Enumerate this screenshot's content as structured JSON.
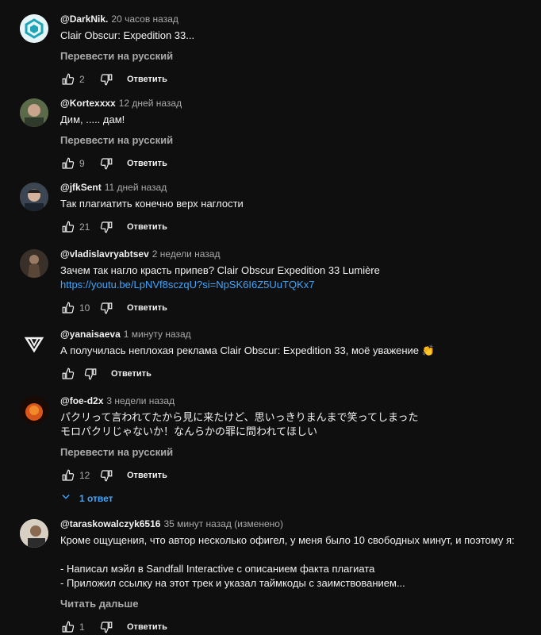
{
  "comments": [
    {
      "author": "@DarkNik.",
      "time": "20 часов назад",
      "text": "Clair Obscur: Expedition 33...",
      "translate": "Перевести на русский",
      "likes": "2",
      "reply": "Ответить"
    },
    {
      "author": "@Kortexxxx",
      "time": "12 дней назад",
      "text": "Дим, ..... дам!",
      "translate": "Перевести на русский",
      "likes": "9",
      "reply": "Ответить"
    },
    {
      "author": "@jfkSent",
      "time": "11 дней назад",
      "text": "Так плагиатить конечно верх наглости",
      "likes": "21",
      "reply": "Ответить"
    },
    {
      "author": "@vladislavryabtsev",
      "time": "2 недели назад",
      "text": "Зачем так нагло красть припев? Clair Obscur Expedition 33 Lumière",
      "link": "https://youtu.be/LpNVf8sczqU?si=NpSK6I6Z5UuTQKx7",
      "likes": "10",
      "reply": "Ответить"
    },
    {
      "author": "@yanaisaeva",
      "time": "1 минуту назад",
      "text": "А получилась неплохая реклама Clair Obscur: Expedition 33, моё уважение 👏",
      "likes": "",
      "reply": "Ответить"
    },
    {
      "author": "@foe-d2x",
      "time": "3 недели назад",
      "text": "パクリって言われてたから見に来たけど、思いっきりまんまで笑ってしまった\nモロパクリじゃないか！なんらかの罪に問われてほしい",
      "translate": "Перевести на русский",
      "likes": "12",
      "reply": "Ответить",
      "replies": "1 ответ"
    },
    {
      "author": "@taraskowalczyk6516",
      "time": "35 минут назад (изменено)",
      "text": "Кроме ощущения, что автор несколько офигел, у меня было 10 свободных минут, и поэтому я:\n\n- Написал мэйл в Sandfall Interactive с описанием факта плагиата\n- Приложил ссылку на этот трек и указал таймкоды с заимствованием...",
      "more": "Читать дальше",
      "likes": "1",
      "reply": "Ответить"
    }
  ],
  "colors": {
    "background": "#0f0f0f",
    "text": "#f1f1f1",
    "secondary": "#aaaaaa",
    "link": "#3ea6ff"
  },
  "icons": [
    "like-icon",
    "dislike-icon",
    "chevron-down-icon"
  ]
}
